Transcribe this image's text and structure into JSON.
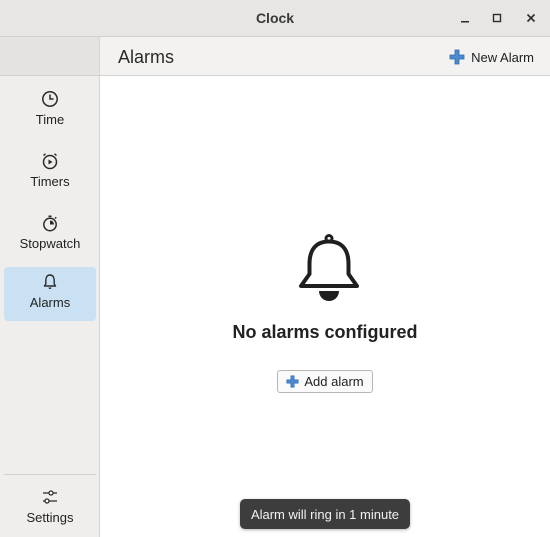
{
  "window": {
    "title": "Clock",
    "controls": [
      "minimize",
      "maximize",
      "close"
    ]
  },
  "sidebar": {
    "items": [
      {
        "label": "Time",
        "icon": "clock-icon",
        "active": false
      },
      {
        "label": "Timers",
        "icon": "timer-icon",
        "active": false
      },
      {
        "label": "Stopwatch",
        "icon": "stopwatch-icon",
        "active": false
      },
      {
        "label": "Alarms",
        "icon": "bell-icon",
        "active": true
      }
    ],
    "settings_label": "Settings"
  },
  "header": {
    "title": "Alarms",
    "new_alarm_label": "New Alarm"
  },
  "main": {
    "empty_message": "No alarms configured",
    "add_alarm_label": "Add alarm"
  },
  "toast": {
    "message": "Alarm will ring in 1 minute"
  },
  "colors": {
    "accent_selected": "#c9e1f2",
    "plus_icon": "#4a8bd0",
    "toast_bg": "#3d3d3d"
  }
}
